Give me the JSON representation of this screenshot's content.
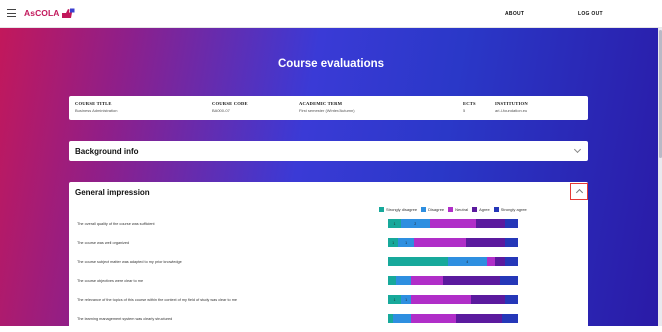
{
  "header": {
    "logo_text": "AsCOLA",
    "nav": [
      {
        "label": "ABOUT"
      },
      {
        "label": "LOG OUT"
      }
    ]
  },
  "page_title": "Course evaluations",
  "course": {
    "columns": [
      {
        "head": "COURSE TITLE",
        "value": "Business Administration"
      },
      {
        "head": "COURSE CODE",
        "value": "BA000-07"
      },
      {
        "head": "ACADEMIC TERM",
        "value": "First semester (Winter/Autumn)"
      },
      {
        "head": "ECTS",
        "value": "5"
      },
      {
        "head": "INSTITUTION",
        "value": "ari-l-foundation.eu"
      }
    ]
  },
  "sections": {
    "background": {
      "title": "Background info"
    },
    "general": {
      "title": "General impression"
    }
  },
  "legend": [
    {
      "label": "Strongly disagree",
      "color": "#17a99b"
    },
    {
      "label": "Disagree",
      "color": "#2e8fe0"
    },
    {
      "label": "Neutral",
      "color": "#b02ec8"
    },
    {
      "label": "Agree",
      "color": "#5b1a9e"
    },
    {
      "label": "Strongly agree",
      "color": "#2537b8"
    }
  ],
  "questions": [
    {
      "text": "The overall quality of the course was sufficient",
      "shares": [
        0.1,
        0.22,
        0.36,
        0.22,
        0.1
      ],
      "labels": [
        "1",
        "2",
        "",
        "",
        ""
      ]
    },
    {
      "text": "The course was well organized",
      "shares": [
        0.08,
        0.12,
        0.4,
        0.3,
        0.1
      ],
      "labels": [
        "1",
        "1",
        "",
        "",
        ""
      ]
    },
    {
      "text": "The course subject matter was adapted to my prior knowledge",
      "shares": [
        0.46,
        0.3,
        0.06,
        0.08,
        0.1
      ],
      "labels": [
        "",
        "4",
        "",
        "",
        ""
      ]
    },
    {
      "text": "The course objectives were clear to me",
      "shares": [
        0.06,
        0.12,
        0.24,
        0.44,
        0.14
      ],
      "labels": [
        "",
        "",
        "",
        "",
        ""
      ]
    },
    {
      "text": "The relevance of the topics of this course within the context of my field of study was clear to me",
      "shares": [
        0.1,
        0.08,
        0.46,
        0.26,
        0.1
      ],
      "labels": [
        "1",
        "1",
        "",
        "",
        ""
      ]
    },
    {
      "text": "The learning management system was clearly structured",
      "shares": [
        0.04,
        0.14,
        0.34,
        0.36,
        0.12
      ],
      "labels": [
        "",
        "",
        "",
        "",
        ""
      ]
    }
  ]
}
